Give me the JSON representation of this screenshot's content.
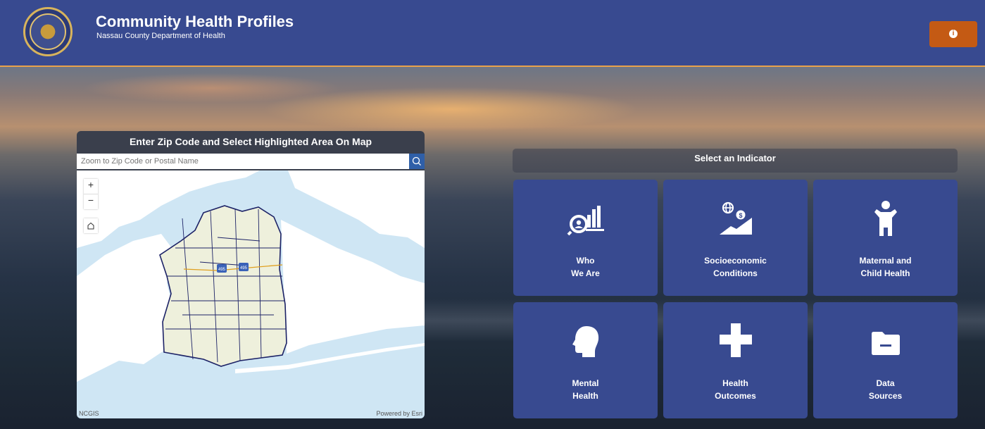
{
  "header": {
    "title": "Community Health Profiles",
    "subtitle": "Nassau County Department of Health",
    "logo_icon": "county-seal-icon",
    "info_icon": "info-icon",
    "brand_color": "#384a90",
    "info_button_color": "#c45a14"
  },
  "map_panel": {
    "heading": "Enter Zip Code and Select Highlighted Area On Map",
    "search": {
      "placeholder": "Zoom to Zip Code or Postal Name",
      "value": ""
    },
    "zoom_in_label": "+",
    "zoom_out_label": "−",
    "home_icon": "home-icon",
    "attribution_left": "NCGIS",
    "attribution_right": "Powered by Esri",
    "highway_shields": [
      "495",
      "495"
    ]
  },
  "indicators": {
    "heading": "Select an Indicator",
    "tiles": [
      {
        "label": "Who\nWe Are",
        "icon": "search-chart-icon"
      },
      {
        "label": "Socioeconomic\nConditions",
        "icon": "globe-money-icon"
      },
      {
        "label": "Maternal and\nChild Health",
        "icon": "child-icon"
      },
      {
        "label": "Mental\nHealth",
        "icon": "head-icon"
      },
      {
        "label": "Health\nOutcomes",
        "icon": "plus-icon"
      },
      {
        "label": "Data\nSources",
        "icon": "folder-icon"
      }
    ]
  }
}
